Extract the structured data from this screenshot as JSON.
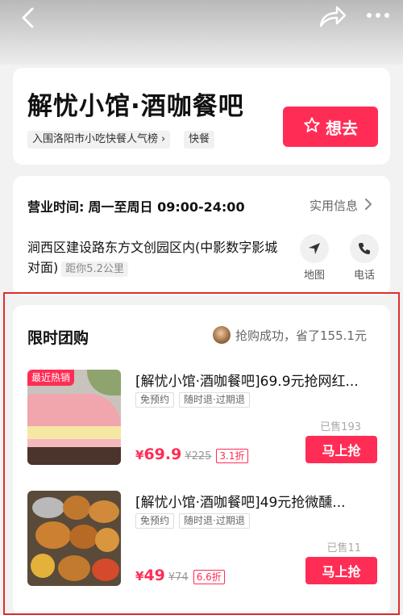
{
  "nav": {
    "back_icon": "chevron-left-icon",
    "share_icon": "share-arrow-icon",
    "more_icon": "more-dots-icon"
  },
  "shop": {
    "name": "解忧小馆·酒咖餐吧",
    "rank_tag": "入围洛阳市小吃快餐人气榜",
    "rank_chevron": "›",
    "category_tag": "快餐",
    "want_label": "想去"
  },
  "info": {
    "hours_label": "营业时间:",
    "hours_value": "周一至周日 09:00-24:00",
    "info_link": "实用信息",
    "address": "涧西区建设路东方文创园区内(中影数字影城对面)",
    "distance": "距你5.2公里",
    "map_label": "地图",
    "phone_label": "电话"
  },
  "deals_section": {
    "title": "限时团购",
    "success_text": "抢购成功，省了155.1元",
    "items": [
      {
        "badge": "最近热销",
        "title": "[解忧小馆·酒咖餐吧]69.9元抢网红...",
        "tags": [
          "免预约",
          "随时退·过期退"
        ],
        "sold": "已售193",
        "currency": "¥",
        "price": "69.9",
        "original": "¥225",
        "discount": "3.1折",
        "button": "马上抢"
      },
      {
        "badge": "",
        "title": "[解忧小馆·酒咖餐吧]49元抢微醺...",
        "tags": [
          "免预约",
          "随时退·过期退"
        ],
        "sold": "已售11",
        "currency": "¥",
        "price": "49",
        "original": "¥74",
        "discount": "6.6折",
        "button": "马上抢"
      }
    ]
  },
  "colors": {
    "accent": "#ff2d55",
    "highlight_border": "#e12d2d"
  }
}
